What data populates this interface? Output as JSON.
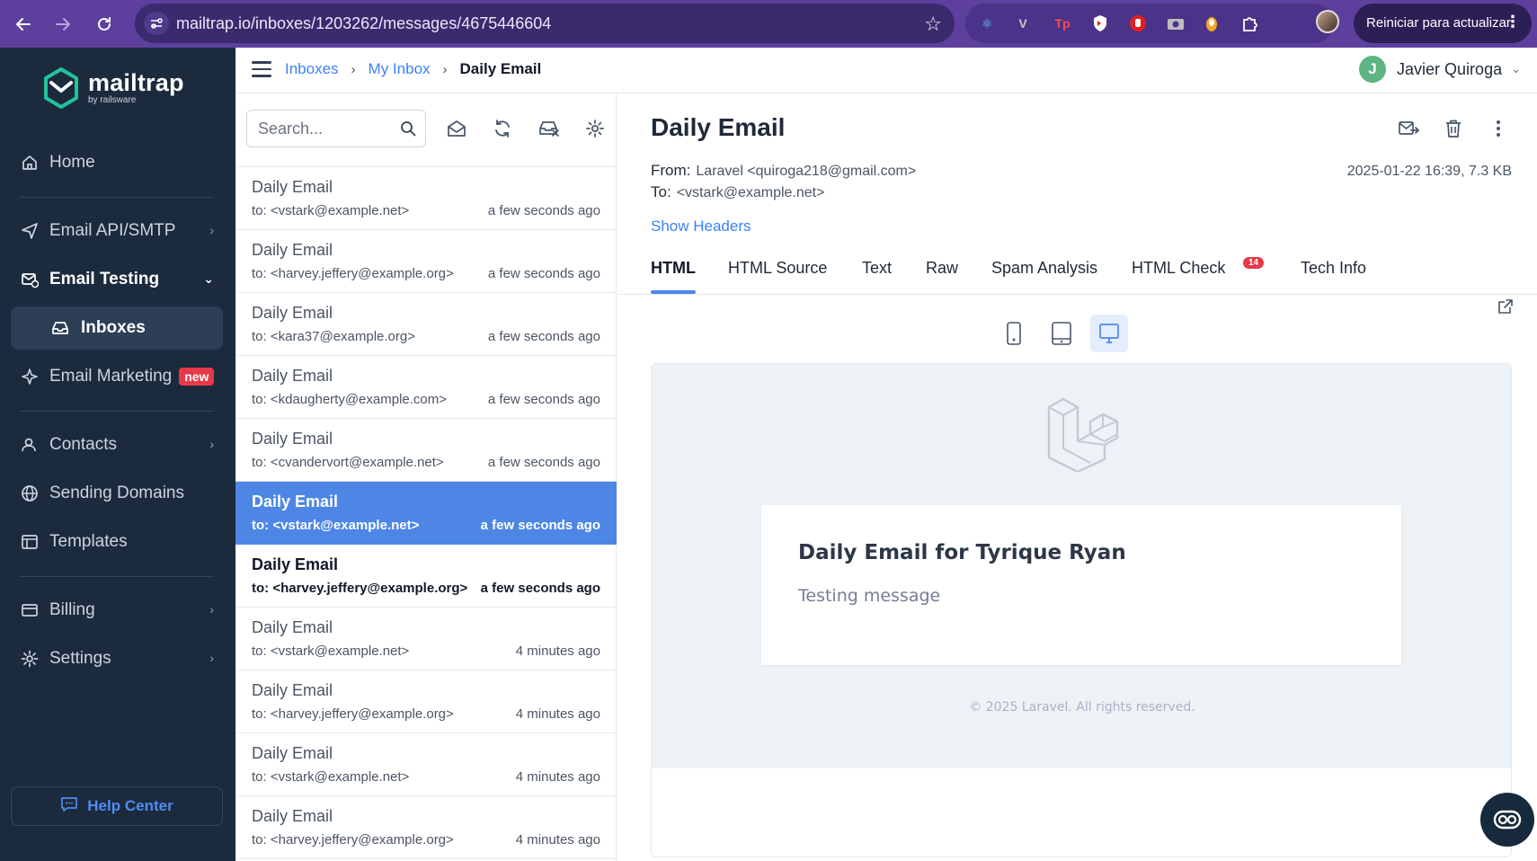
{
  "browser": {
    "url": "mailtrap.io/inboxes/1203262/messages/4675446604",
    "update_label": "Reiniciar para actualizar"
  },
  "sidebar": {
    "logo_text": "mailtrap",
    "logo_sub": "by railsware",
    "items": [
      {
        "label": "Home"
      },
      {
        "label": "Email API/SMTP"
      },
      {
        "label": "Email Testing"
      },
      {
        "label": "Inboxes"
      },
      {
        "label": "Email Marketing",
        "badge": "new"
      },
      {
        "label": "Contacts"
      },
      {
        "label": "Sending Domains"
      },
      {
        "label": "Templates"
      },
      {
        "label": "Billing"
      },
      {
        "label": "Settings"
      }
    ],
    "help_center": "Help Center"
  },
  "header": {
    "breadcrumbs": [
      "Inboxes",
      "My Inbox",
      "Daily Email"
    ],
    "user_initial": "J",
    "user_name": "Javier Quiroga"
  },
  "list": {
    "search_placeholder": "Search...",
    "messages": [
      {
        "subject": "Daily Email",
        "to": "to: <vstark@example.net>",
        "time": "a few seconds ago"
      },
      {
        "subject": "Daily Email",
        "to": "to: <harvey.jeffery@example.org>",
        "time": "a few seconds ago"
      },
      {
        "subject": "Daily Email",
        "to": "to: <kara37@example.org>",
        "time": "a few seconds ago"
      },
      {
        "subject": "Daily Email",
        "to": "to: <kdaugherty@example.com>",
        "time": "a few seconds ago"
      },
      {
        "subject": "Daily Email",
        "to": "to: <cvandervort@example.net>",
        "time": "a few seconds ago"
      },
      {
        "subject": "Daily Email",
        "to": "to: <vstark@example.net>",
        "time": "a few seconds ago"
      },
      {
        "subject": "Daily Email",
        "to": "to: <harvey.jeffery@example.org>",
        "time": "a few seconds ago"
      },
      {
        "subject": "Daily Email",
        "to": "to: <vstark@example.net>",
        "time": "4 minutes ago"
      },
      {
        "subject": "Daily Email",
        "to": "to: <harvey.jeffery@example.org>",
        "time": "4 minutes ago"
      },
      {
        "subject": "Daily Email",
        "to": "to: <vstark@example.net>",
        "time": "4 minutes ago"
      },
      {
        "subject": "Daily Email",
        "to": "to: <harvey.jeffery@example.org>",
        "time": "4 minutes ago"
      }
    ]
  },
  "detail": {
    "title": "Daily Email",
    "from_label": "From:",
    "from_value": "Laravel <quiroga218@gmail.com>",
    "to_label": "To:",
    "to_value": "<vstark@example.net>",
    "meta": "2025-01-22 16:39, 7.3 KB",
    "show_headers": "Show Headers",
    "tabs": [
      {
        "label": "HTML"
      },
      {
        "label": "HTML Source"
      },
      {
        "label": "Text"
      },
      {
        "label": "Raw"
      },
      {
        "label": "Spam Analysis"
      },
      {
        "label": "HTML Check",
        "badge": "14"
      },
      {
        "label": "Tech Info"
      }
    ]
  },
  "email": {
    "heading": "Daily Email for Tyrique Ryan",
    "body": "Testing message",
    "footer": "© 2025 Laravel. All rights reserved."
  }
}
